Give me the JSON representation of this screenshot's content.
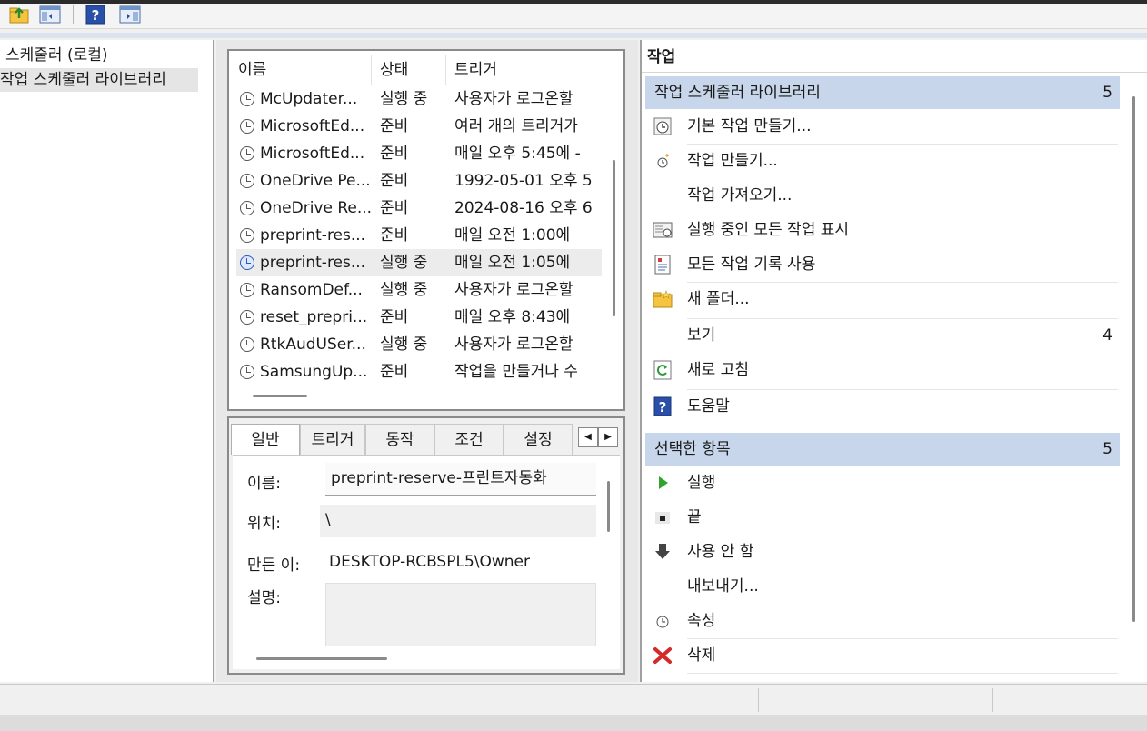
{
  "toolbar": {
    "buttons": [
      {
        "icon": "folder-up-icon"
      },
      {
        "icon": "show-hide-console-tree-icon"
      },
      {
        "icon": "help-icon"
      },
      {
        "icon": "show-hide-action-pane-icon"
      }
    ]
  },
  "tree": {
    "items": [
      {
        "label": "스케줄러 (로컬)"
      },
      {
        "label": "작업 스케줄러 라이브러리",
        "selected": true
      }
    ]
  },
  "task_list": {
    "columns": [
      "이름",
      "상태",
      "트리거"
    ],
    "rows": [
      {
        "name": "McUpdater...",
        "status": "실행 중",
        "trigger": "사용자가 로그온할"
      },
      {
        "name": "MicrosoftEd...",
        "status": "준비",
        "trigger": "여러 개의 트리거가"
      },
      {
        "name": "MicrosoftEd...",
        "status": "준비",
        "trigger": "매일 오후 5:45에 -"
      },
      {
        "name": "OneDrive Pe...",
        "status": "준비",
        "trigger": "1992-05-01 오후 5"
      },
      {
        "name": "OneDrive Re...",
        "status": "준비",
        "trigger": "2024-08-16 오후 6"
      },
      {
        "name": "preprint-res...",
        "status": "준비",
        "trigger": "매일 오전 1:00에"
      },
      {
        "name": "preprint-res...",
        "status": "실행 중",
        "trigger": "매일 오전 1:05에",
        "selected": true
      },
      {
        "name": "RansomDef...",
        "status": "실행 중",
        "trigger": "사용자가 로그온할"
      },
      {
        "name": "reset_prepri...",
        "status": "준비",
        "trigger": "매일 오후 8:43에"
      },
      {
        "name": "RtkAudUSer...",
        "status": "실행 중",
        "trigger": "사용자가 로그온할"
      },
      {
        "name": "SamsungUp...",
        "status": "준비",
        "trigger": "작업을 만들거나 수"
      }
    ]
  },
  "detail": {
    "tabs": [
      "일반",
      "트리거",
      "동작",
      "조건",
      "설정"
    ],
    "active_tab": "일반",
    "name_label": "이름:",
    "name_value": "preprint-reserve-프린트자동화",
    "location_label": "위치:",
    "location_value": "\\",
    "author_label": "만든 이:",
    "author_value": "DESKTOP-RCBSPL5\\Owner",
    "description_label": "설명:",
    "description_value": ""
  },
  "actions": {
    "title": "작업",
    "section1": {
      "title": "작업 스케줄러 라이브러리",
      "count": "5",
      "items": [
        {
          "label": "기본 작업 만들기...",
          "icon": "create-basic-task-icon"
        },
        {
          "label": "작업 만들기...",
          "icon": "create-task-icon"
        },
        {
          "label": "작업 가져오기...",
          "icon": ""
        },
        {
          "label": "실행 중인 모든 작업 표시",
          "icon": "running-tasks-icon"
        },
        {
          "label": "모든 작업 기록 사용",
          "icon": "task-history-icon"
        },
        {
          "label": "새 폴더...",
          "icon": "new-folder-icon"
        },
        {
          "label": "보기",
          "icon": "",
          "count": "4"
        },
        {
          "label": "새로 고침",
          "icon": "refresh-icon"
        },
        {
          "label": "도움말",
          "icon": "help-icon"
        }
      ]
    },
    "section2": {
      "title": "선택한 항목",
      "count": "5",
      "items": [
        {
          "label": "실행",
          "icon": "run-icon"
        },
        {
          "label": "끝",
          "icon": "end-icon"
        },
        {
          "label": "사용 안 함",
          "icon": "disable-icon"
        },
        {
          "label": "내보내기...",
          "icon": ""
        },
        {
          "label": "속성",
          "icon": "properties-icon"
        },
        {
          "label": "삭제",
          "icon": "delete-icon"
        }
      ]
    }
  },
  "colors": {
    "section_header": "#c7d6ea",
    "selected_row": "#ececec",
    "help_blue": "#2a4fa8",
    "run_green": "#2fa52f",
    "delete_red": "#d42a2a"
  }
}
